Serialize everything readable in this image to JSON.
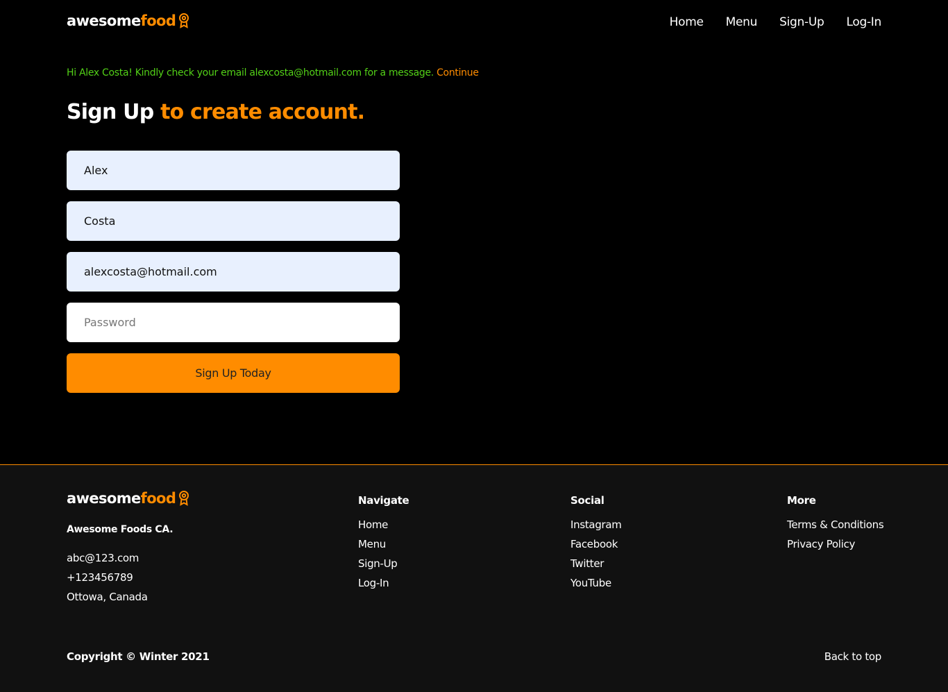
{
  "brand": {
    "name_part1": "awesome",
    "name_part2": "food",
    "icon": "award-badge-icon",
    "accent_color": "#ff8c00",
    "success_color": "#52d017"
  },
  "nav": {
    "items": [
      {
        "label": "Home"
      },
      {
        "label": "Menu"
      },
      {
        "label": "Sign-Up"
      },
      {
        "label": "Log-In"
      }
    ]
  },
  "alert": {
    "message": "Hi Alex Costa! Kindly check your email alexcosta@hotmail.com for a message.",
    "link_label": "Continue"
  },
  "form": {
    "heading_main": "Sign Up",
    "heading_accent": "to create account.",
    "first_name_value": "Alex",
    "last_name_value": "Costa",
    "email_value": "alexcosta@hotmail.com",
    "password_value": "",
    "password_placeholder": "Password",
    "submit_label": "Sign Up Today"
  },
  "footer": {
    "company": "Awesome Foods CA.",
    "contact": [
      "abc@123.com",
      "+123456789",
      "Ottowa, Canada"
    ],
    "navigate": {
      "title": "Navigate",
      "items": [
        "Home",
        "Menu",
        "Sign-Up",
        "Log-In"
      ]
    },
    "social": {
      "title": "Social",
      "items": [
        "Instagram",
        "Facebook",
        "Twitter",
        "YouTube"
      ]
    },
    "more": {
      "title": "More",
      "items": [
        "Terms & Conditions",
        "Privacy Policy"
      ]
    },
    "copyright": "Copyright © Winter 2021",
    "back_to_top": "Back to top"
  }
}
